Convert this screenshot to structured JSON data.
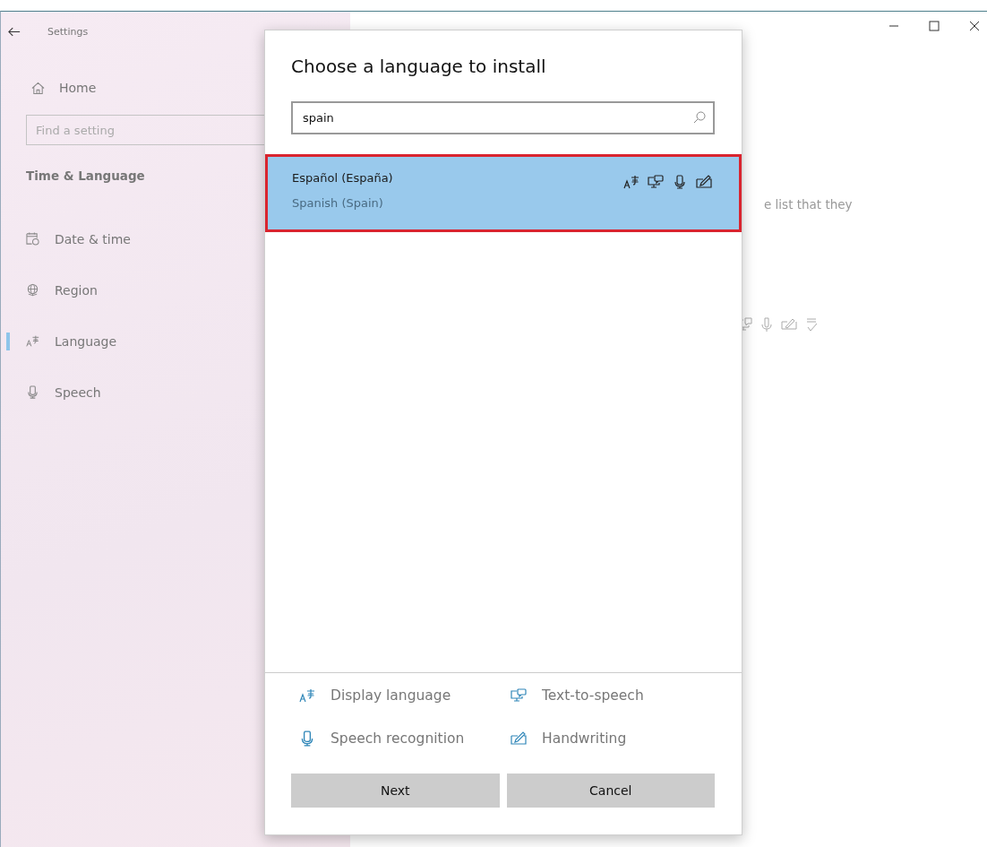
{
  "window": {
    "title": "Settings"
  },
  "sidebar": {
    "home": "Home",
    "search": {
      "placeholder": "Find a setting"
    },
    "section": "Time & Language",
    "items": [
      {
        "label": "Date & time",
        "kind": "calendar",
        "selected": false
      },
      {
        "label": "Region",
        "kind": "globe",
        "selected": false
      },
      {
        "label": "Language",
        "kind": "language",
        "selected": true
      },
      {
        "label": "Speech",
        "kind": "microphone",
        "selected": false
      }
    ]
  },
  "page": {
    "text": "e list that they"
  },
  "dialog": {
    "title": "Choose a language to install",
    "search": {
      "value": "spain"
    },
    "results": [
      {
        "name": "Español (España)",
        "subtitle": "Spanish (Spain)",
        "selected": true,
        "highlighted": true,
        "features": [
          {
            "kind": "display"
          },
          {
            "kind": "tts"
          },
          {
            "kind": "speech"
          },
          {
            "kind": "handwriting"
          }
        ]
      }
    ],
    "legend": [
      {
        "kind": "display",
        "label": "Display language"
      },
      {
        "kind": "tts",
        "label": "Text-to-speech"
      },
      {
        "kind": "speech",
        "label": "Speech recognition"
      },
      {
        "kind": "handwriting",
        "label": "Handwriting"
      }
    ],
    "buttons": [
      "Next",
      "Cancel"
    ]
  }
}
